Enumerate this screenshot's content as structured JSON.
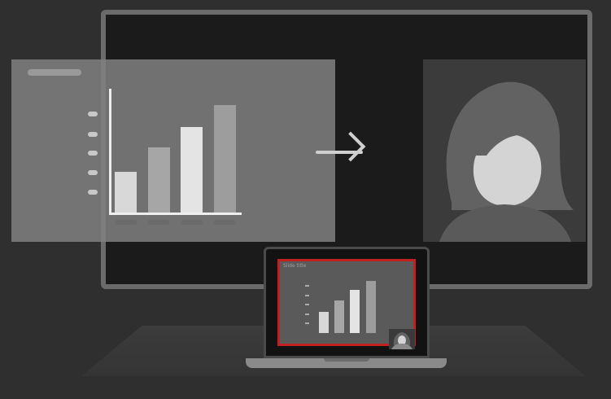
{
  "slide": {
    "chart_bars": [
      {
        "level": 0.33,
        "color": "#d8d8d8"
      },
      {
        "level": 0.53,
        "color": "#a6a6a6"
      },
      {
        "level": 0.7,
        "color": "#e4e4e4"
      },
      {
        "level": 0.88,
        "color": "#9d9d9d"
      }
    ]
  },
  "laptop": {
    "mini_title": "Slide title",
    "screen_border_color": "#c0201e",
    "mini_bars": [
      {
        "level": 0.3,
        "color": "#d8d8d8"
      },
      {
        "level": 0.45,
        "color": "#a6a6a6"
      },
      {
        "level": 0.6,
        "color": "#e4e4e4"
      },
      {
        "level": 0.73,
        "color": "#9d9d9d"
      }
    ]
  },
  "icons": {
    "arrow": "arrow-right-icon",
    "person": "person-avatar-icon",
    "laptop": "laptop-icon"
  }
}
